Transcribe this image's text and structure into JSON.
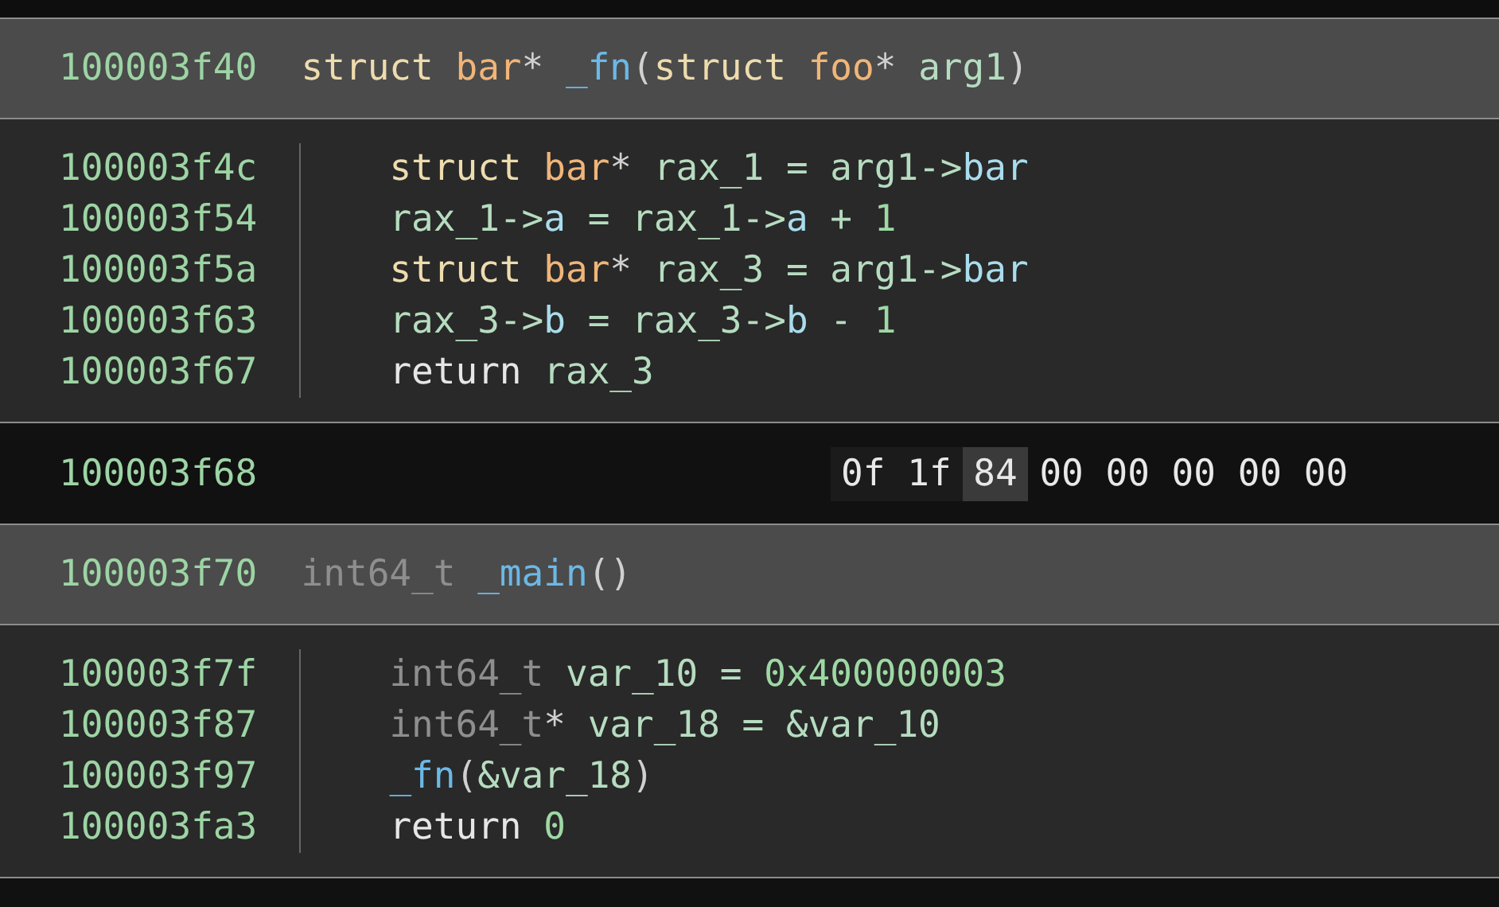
{
  "blocks": [
    {
      "kind": "function",
      "address": "100003f40",
      "signature": [
        {
          "kind": "keyword",
          "text": "struct "
        },
        {
          "kind": "type",
          "text": "bar"
        },
        {
          "kind": "punct",
          "text": "* "
        },
        {
          "kind": "func",
          "text": "_fn"
        },
        {
          "kind": "punct",
          "text": "("
        },
        {
          "kind": "keyword",
          "text": "struct "
        },
        {
          "kind": "type",
          "text": "foo"
        },
        {
          "kind": "punct",
          "text": "* "
        },
        {
          "kind": "var",
          "text": "arg1"
        },
        {
          "kind": "punct",
          "text": ")"
        }
      ],
      "lines": [
        {
          "address": "100003f4c",
          "tokens": [
            {
              "kind": "keyword",
              "text": "struct "
            },
            {
              "kind": "type",
              "text": "bar"
            },
            {
              "kind": "punct",
              "text": "* "
            },
            {
              "kind": "var",
              "text": "rax_1 = arg1->"
            },
            {
              "kind": "field",
              "text": "bar"
            }
          ]
        },
        {
          "address": "100003f54",
          "tokens": [
            {
              "kind": "var",
              "text": "rax_1->"
            },
            {
              "kind": "field",
              "text": "a"
            },
            {
              "kind": "var",
              "text": " = rax_1->"
            },
            {
              "kind": "field",
              "text": "a"
            },
            {
              "kind": "var",
              "text": " + "
            },
            {
              "kind": "number",
              "text": "1"
            }
          ]
        },
        {
          "address": "100003f5a",
          "tokens": [
            {
              "kind": "keyword",
              "text": "struct "
            },
            {
              "kind": "type",
              "text": "bar"
            },
            {
              "kind": "punct",
              "text": "* "
            },
            {
              "kind": "var",
              "text": "rax_3 = arg1->"
            },
            {
              "kind": "field",
              "text": "bar"
            }
          ]
        },
        {
          "address": "100003f63",
          "tokens": [
            {
              "kind": "var",
              "text": "rax_3->"
            },
            {
              "kind": "field",
              "text": "b"
            },
            {
              "kind": "var",
              "text": " = rax_3->"
            },
            {
              "kind": "field",
              "text": "b"
            },
            {
              "kind": "var",
              "text": " - "
            },
            {
              "kind": "number",
              "text": "1"
            }
          ]
        },
        {
          "address": "100003f67",
          "tokens": [
            {
              "kind": "plain",
              "text": "return "
            },
            {
              "kind": "var",
              "text": "rax_3"
            }
          ]
        }
      ]
    },
    {
      "kind": "data",
      "address": "100003f68",
      "bytes": [
        {
          "text": "0f",
          "selected": false
        },
        {
          "text": "1f",
          "selected": false
        },
        {
          "text": "84",
          "selected": true
        },
        {
          "text": "00",
          "selected": false
        },
        {
          "text": "00",
          "selected": false
        },
        {
          "text": "00",
          "selected": false
        },
        {
          "text": "00",
          "selected": false
        },
        {
          "text": "00",
          "selected": false
        }
      ]
    },
    {
      "kind": "function",
      "address": "100003f70",
      "signature": [
        {
          "kind": "dimtype",
          "text": "int64_t "
        },
        {
          "kind": "func",
          "text": "_main"
        },
        {
          "kind": "punct",
          "text": "()"
        }
      ],
      "lines": [
        {
          "address": "100003f7f",
          "tokens": [
            {
              "kind": "dimtype",
              "text": "int64_t "
            },
            {
              "kind": "var",
              "text": "var_10 = "
            },
            {
              "kind": "number",
              "text": "0x400000003"
            }
          ]
        },
        {
          "address": "100003f87",
          "tokens": [
            {
              "kind": "dimtype",
              "text": "int64_t"
            },
            {
              "kind": "punct",
              "text": "* "
            },
            {
              "kind": "var",
              "text": "var_18 = &var_10"
            }
          ]
        },
        {
          "address": "100003f97",
          "tokens": [
            {
              "kind": "func",
              "text": "_fn"
            },
            {
              "kind": "punct",
              "text": "("
            },
            {
              "kind": "var",
              "text": "&var_18"
            },
            {
              "kind": "punct",
              "text": ")"
            }
          ]
        },
        {
          "address": "100003fa3",
          "tokens": [
            {
              "kind": "plain",
              "text": "return "
            },
            {
              "kind": "number",
              "text": "0"
            }
          ]
        }
      ]
    }
  ]
}
